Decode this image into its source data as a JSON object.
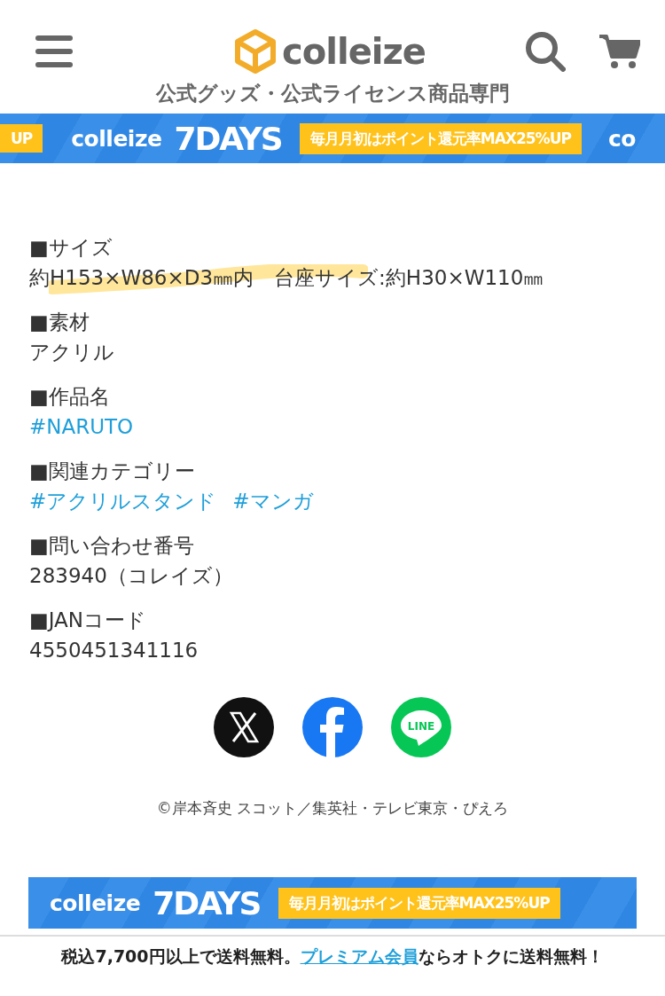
{
  "header": {
    "logo": "colleize",
    "tagline": "公式グッズ・公式ライセンス商品専門"
  },
  "top_banner": {
    "lead_fragment": "UP",
    "brand": "colleize",
    "title": "7DAYS",
    "offer": "毎月月初はポイント還元率MAX25%UP",
    "tail_fragment": "co"
  },
  "specs": [
    {
      "heading": "■サイズ",
      "values": [
        {
          "kind": "text",
          "text": "約H153×W86×D3㎜内　台座サイズ:約H30×W110㎜",
          "highlighted": true
        }
      ]
    },
    {
      "heading": "■素材",
      "values": [
        {
          "kind": "text",
          "text": "アクリル",
          "highlighted": false
        }
      ]
    },
    {
      "heading": "■作品名",
      "values": [
        {
          "kind": "tag",
          "text": "#NARUTO",
          "highlighted": false
        }
      ]
    },
    {
      "heading": "■関連カテゴリー",
      "values": [
        {
          "kind": "tag",
          "text": "#アクリルスタンド",
          "highlighted": false
        },
        {
          "kind": "tag",
          "text": "#マンガ",
          "highlighted": false
        }
      ]
    },
    {
      "heading": "■問い合わせ番号",
      "values": [
        {
          "kind": "text",
          "text": "283940（コレイズ）",
          "highlighted": false
        }
      ]
    },
    {
      "heading": "■JANコード",
      "values": [
        {
          "kind": "text",
          "text": "4550451341116",
          "highlighted": false
        }
      ]
    }
  ],
  "share": [
    {
      "kind": "x"
    },
    {
      "kind": "facebook"
    },
    {
      "kind": "line",
      "label": "LINE"
    }
  ],
  "copyright": "©岸本斉史 スコット／集英社・テレビ東京・ぴえろ",
  "bottom_banner": {
    "brand": "colleize",
    "title": "7DAYS",
    "offer": "毎月月初はポイント還元率MAX25%UP"
  },
  "shipping_notice": {
    "before": "税込7,700円以上で送料無料。",
    "link": "プレミアム会員",
    "after": "ならオトクに送料無料！"
  }
}
